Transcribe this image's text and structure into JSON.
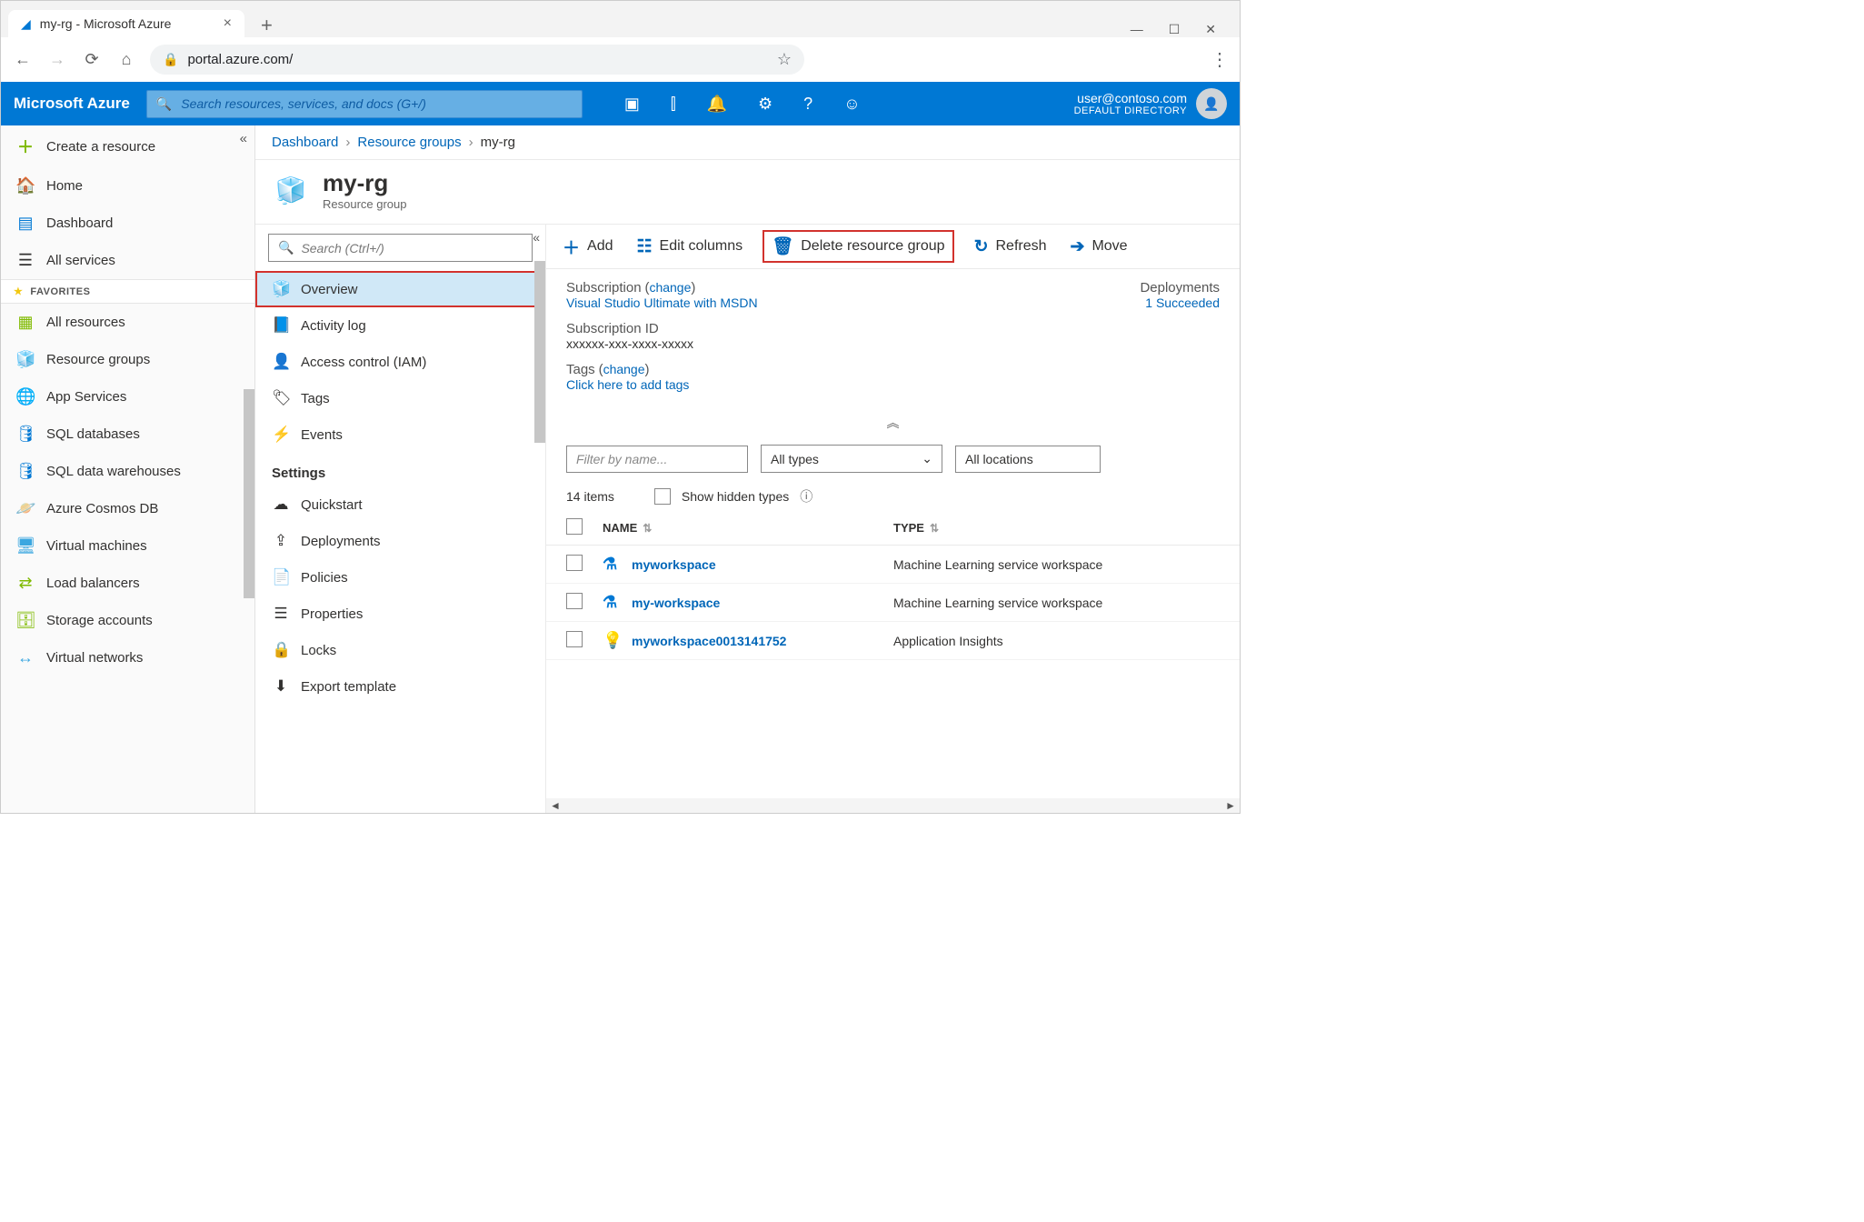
{
  "browser": {
    "tab_title": "my-rg - Microsoft Azure",
    "url": "portal.azure.com/"
  },
  "header": {
    "brand": "Microsoft Azure",
    "search_placeholder": "Search resources, services, and docs (G+/)",
    "user_email": "user@contoso.com",
    "user_dir": "DEFAULT DIRECTORY"
  },
  "leftnav": {
    "create": "Create a resource",
    "home": "Home",
    "dashboard": "Dashboard",
    "all_services": "All services",
    "favorites_label": "FAVORITES",
    "favorites": [
      {
        "label": "All resources",
        "icon": "▦",
        "color": "#7fba00"
      },
      {
        "label": "Resource groups",
        "icon": "🧊",
        "color": "#3ba7e0"
      },
      {
        "label": "App Services",
        "icon": "🌐",
        "color": "#3ba7e0"
      },
      {
        "label": "SQL databases",
        "icon": "🛢",
        "color": "#0078d4"
      },
      {
        "label": "SQL data warehouses",
        "icon": "🛢",
        "color": "#0078d4"
      },
      {
        "label": "Azure Cosmos DB",
        "icon": "🪐",
        "color": "#1b3a6b"
      },
      {
        "label": "Virtual machines",
        "icon": "🖥",
        "color": "#3ba7e0"
      },
      {
        "label": "Load balancers",
        "icon": "⇄",
        "color": "#7fba00"
      },
      {
        "label": "Storage accounts",
        "icon": "🗄",
        "color": "#7fba00"
      },
      {
        "label": "Virtual networks",
        "icon": "↔",
        "color": "#3ba7e0"
      }
    ]
  },
  "breadcrumb": {
    "a": "Dashboard",
    "b": "Resource groups",
    "c": "my-rg"
  },
  "blade": {
    "title": "my-rg",
    "subtitle": "Resource group",
    "menu_search_placeholder": "Search (Ctrl+/)",
    "menu": [
      {
        "label": "Overview",
        "icon": "🧊",
        "active": true
      },
      {
        "label": "Activity log",
        "icon": "📘"
      },
      {
        "label": "Access control (IAM)",
        "icon": "👤"
      },
      {
        "label": "Tags",
        "icon": "🏷"
      },
      {
        "label": "Events",
        "icon": "⚡"
      }
    ],
    "settings_label": "Settings",
    "settings": [
      {
        "label": "Quickstart",
        "icon": "☁"
      },
      {
        "label": "Deployments",
        "icon": "⇪"
      },
      {
        "label": "Policies",
        "icon": "📄"
      },
      {
        "label": "Properties",
        "icon": "☰"
      },
      {
        "label": "Locks",
        "icon": "🔒"
      },
      {
        "label": "Export template",
        "icon": "⬇"
      }
    ]
  },
  "commands": {
    "add": "Add",
    "edit_columns": "Edit columns",
    "delete": "Delete resource group",
    "refresh": "Refresh",
    "move": "Move"
  },
  "essentials": {
    "sub_label": "Subscription",
    "change": "change",
    "sub_value": "Visual Studio Ultimate with MSDN",
    "subid_label": "Subscription ID",
    "subid_value": "xxxxxx-xxx-xxxx-xxxxx",
    "tags_label": "Tags",
    "tags_value": "Click here to add tags",
    "deployments_label": "Deployments",
    "deployments_value": "1 Succeeded"
  },
  "content": {
    "filter_placeholder": "Filter by name...",
    "filter_types": "All types",
    "filter_locations": "All locations",
    "items_count": "14 items",
    "show_hidden": "Show hidden types",
    "col_name": "NAME",
    "col_type": "TYPE",
    "rows": [
      {
        "name": "myworkspace",
        "type": "Machine Learning service workspace",
        "icon": "⚗"
      },
      {
        "name": "my-workspace",
        "type": "Machine Learning service workspace",
        "icon": "⚗"
      },
      {
        "name": "myworkspace0013141752",
        "type": "Application Insights",
        "icon": "💡"
      }
    ]
  }
}
